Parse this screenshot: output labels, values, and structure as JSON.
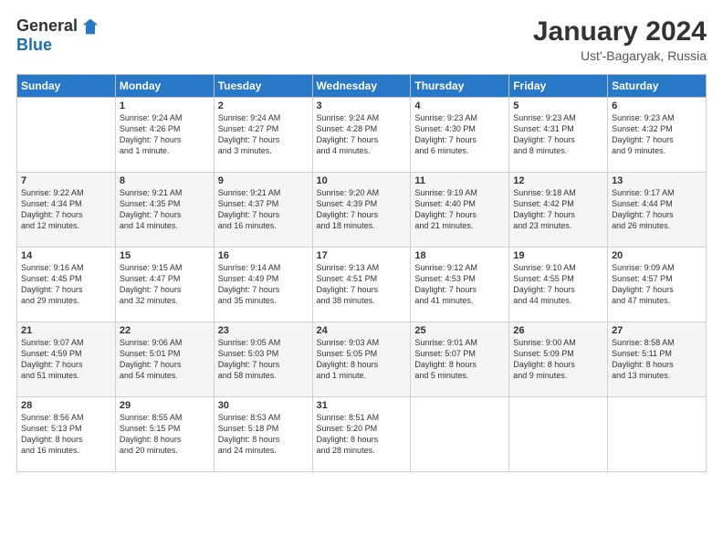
{
  "logo": {
    "general": "General",
    "blue": "Blue"
  },
  "title": "January 2024",
  "location": "Ust'-Bagaryak, Russia",
  "days_of_week": [
    "Sunday",
    "Monday",
    "Tuesday",
    "Wednesday",
    "Thursday",
    "Friday",
    "Saturday"
  ],
  "weeks": [
    [
      {
        "day": "",
        "content": ""
      },
      {
        "day": "1",
        "content": "Sunrise: 9:24 AM\nSunset: 4:26 PM\nDaylight: 7 hours\nand 1 minute."
      },
      {
        "day": "2",
        "content": "Sunrise: 9:24 AM\nSunset: 4:27 PM\nDaylight: 7 hours\nand 3 minutes."
      },
      {
        "day": "3",
        "content": "Sunrise: 9:24 AM\nSunset: 4:28 PM\nDaylight: 7 hours\nand 4 minutes."
      },
      {
        "day": "4",
        "content": "Sunrise: 9:23 AM\nSunset: 4:30 PM\nDaylight: 7 hours\nand 6 minutes."
      },
      {
        "day": "5",
        "content": "Sunrise: 9:23 AM\nSunset: 4:31 PM\nDaylight: 7 hours\nand 8 minutes."
      },
      {
        "day": "6",
        "content": "Sunrise: 9:23 AM\nSunset: 4:32 PM\nDaylight: 7 hours\nand 9 minutes."
      }
    ],
    [
      {
        "day": "7",
        "content": "Sunrise: 9:22 AM\nSunset: 4:34 PM\nDaylight: 7 hours\nand 12 minutes."
      },
      {
        "day": "8",
        "content": "Sunrise: 9:21 AM\nSunset: 4:35 PM\nDaylight: 7 hours\nand 14 minutes."
      },
      {
        "day": "9",
        "content": "Sunrise: 9:21 AM\nSunset: 4:37 PM\nDaylight: 7 hours\nand 16 minutes."
      },
      {
        "day": "10",
        "content": "Sunrise: 9:20 AM\nSunset: 4:39 PM\nDaylight: 7 hours\nand 18 minutes."
      },
      {
        "day": "11",
        "content": "Sunrise: 9:19 AM\nSunset: 4:40 PM\nDaylight: 7 hours\nand 21 minutes."
      },
      {
        "day": "12",
        "content": "Sunrise: 9:18 AM\nSunset: 4:42 PM\nDaylight: 7 hours\nand 23 minutes."
      },
      {
        "day": "13",
        "content": "Sunrise: 9:17 AM\nSunset: 4:44 PM\nDaylight: 7 hours\nand 26 minutes."
      }
    ],
    [
      {
        "day": "14",
        "content": "Sunrise: 9:16 AM\nSunset: 4:45 PM\nDaylight: 7 hours\nand 29 minutes."
      },
      {
        "day": "15",
        "content": "Sunrise: 9:15 AM\nSunset: 4:47 PM\nDaylight: 7 hours\nand 32 minutes."
      },
      {
        "day": "16",
        "content": "Sunrise: 9:14 AM\nSunset: 4:49 PM\nDaylight: 7 hours\nand 35 minutes."
      },
      {
        "day": "17",
        "content": "Sunrise: 9:13 AM\nSunset: 4:51 PM\nDaylight: 7 hours\nand 38 minutes."
      },
      {
        "day": "18",
        "content": "Sunrise: 9:12 AM\nSunset: 4:53 PM\nDaylight: 7 hours\nand 41 minutes."
      },
      {
        "day": "19",
        "content": "Sunrise: 9:10 AM\nSunset: 4:55 PM\nDaylight: 7 hours\nand 44 minutes."
      },
      {
        "day": "20",
        "content": "Sunrise: 9:09 AM\nSunset: 4:57 PM\nDaylight: 7 hours\nand 47 minutes."
      }
    ],
    [
      {
        "day": "21",
        "content": "Sunrise: 9:07 AM\nSunset: 4:59 PM\nDaylight: 7 hours\nand 51 minutes."
      },
      {
        "day": "22",
        "content": "Sunrise: 9:06 AM\nSunset: 5:01 PM\nDaylight: 7 hours\nand 54 minutes."
      },
      {
        "day": "23",
        "content": "Sunrise: 9:05 AM\nSunset: 5:03 PM\nDaylight: 7 hours\nand 58 minutes."
      },
      {
        "day": "24",
        "content": "Sunrise: 9:03 AM\nSunset: 5:05 PM\nDaylight: 8 hours\nand 1 minute."
      },
      {
        "day": "25",
        "content": "Sunrise: 9:01 AM\nSunset: 5:07 PM\nDaylight: 8 hours\nand 5 minutes."
      },
      {
        "day": "26",
        "content": "Sunrise: 9:00 AM\nSunset: 5:09 PM\nDaylight: 8 hours\nand 9 minutes."
      },
      {
        "day": "27",
        "content": "Sunrise: 8:58 AM\nSunset: 5:11 PM\nDaylight: 8 hours\nand 13 minutes."
      }
    ],
    [
      {
        "day": "28",
        "content": "Sunrise: 8:56 AM\nSunset: 5:13 PM\nDaylight: 8 hours\nand 16 minutes."
      },
      {
        "day": "29",
        "content": "Sunrise: 8:55 AM\nSunset: 5:15 PM\nDaylight: 8 hours\nand 20 minutes."
      },
      {
        "day": "30",
        "content": "Sunrise: 8:53 AM\nSunset: 5:18 PM\nDaylight: 8 hours\nand 24 minutes."
      },
      {
        "day": "31",
        "content": "Sunrise: 8:51 AM\nSunset: 5:20 PM\nDaylight: 8 hours\nand 28 minutes."
      },
      {
        "day": "",
        "content": ""
      },
      {
        "day": "",
        "content": ""
      },
      {
        "day": "",
        "content": ""
      }
    ]
  ]
}
